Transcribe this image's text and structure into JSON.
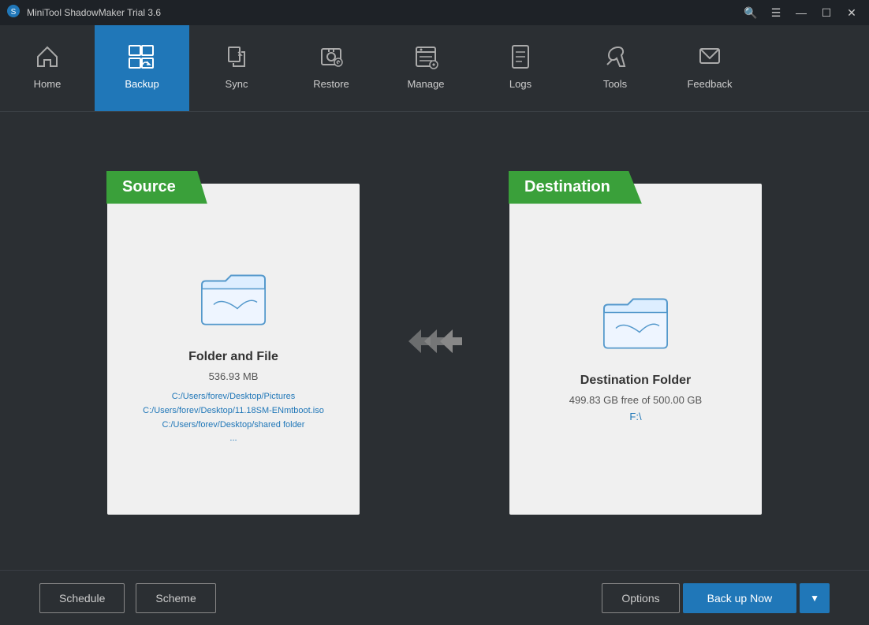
{
  "titleBar": {
    "logo": "⚙",
    "title": "MiniTool ShadowMaker Trial 3.6",
    "controls": {
      "search": "🔍",
      "menu": "☰",
      "minimize": "—",
      "maximize": "☐",
      "close": "✕"
    }
  },
  "nav": {
    "items": [
      {
        "id": "home",
        "label": "Home",
        "icon": "🏠",
        "active": false
      },
      {
        "id": "backup",
        "label": "Backup",
        "icon": "⊞",
        "active": true
      },
      {
        "id": "sync",
        "label": "Sync",
        "icon": "⇄",
        "active": false
      },
      {
        "id": "restore",
        "label": "Restore",
        "icon": "⟳",
        "active": false
      },
      {
        "id": "manage",
        "label": "Manage",
        "icon": "⚙",
        "active": false
      },
      {
        "id": "logs",
        "label": "Logs",
        "icon": "📋",
        "active": false
      },
      {
        "id": "tools",
        "label": "Tools",
        "icon": "🔧",
        "active": false
      },
      {
        "id": "feedback",
        "label": "Feedback",
        "icon": "✉",
        "active": false
      }
    ]
  },
  "source": {
    "header": "Source",
    "title": "Folder and File",
    "size": "536.93 MB",
    "paths": [
      "C:/Users/forev/Desktop/Pictures",
      "C:/Users/forev/Desktop/11.18SM-ENmtboot.iso",
      "C:/Users/forev/Desktop/shared folder",
      "..."
    ]
  },
  "destination": {
    "header": "Destination",
    "title": "Destination Folder",
    "free": "499.83 GB free of 500.00 GB",
    "drive": "F:\\"
  },
  "bottomBar": {
    "schedule": "Schedule",
    "scheme": "Scheme",
    "options": "Options",
    "backupNow": "Back up Now"
  }
}
